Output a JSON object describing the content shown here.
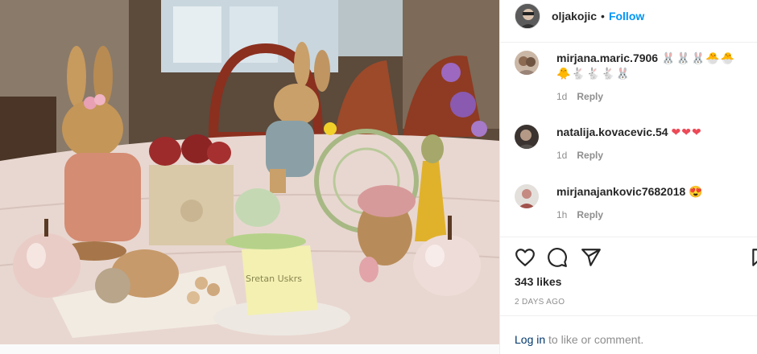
{
  "post": {
    "username": "oljakojic",
    "dot": "•",
    "follow_label": "Follow"
  },
  "photo": {
    "note_text": "Sretan Uskrs"
  },
  "comments": [
    {
      "username": "mirjana.maric.7906",
      "text": "🐰🐰🐰🐣🐣🐥🐇🐇🐇🐰",
      "age": "1d",
      "reply": "Reply"
    },
    {
      "username": "natalija.kovacevic.54",
      "text": "❤❤❤",
      "age": "1d",
      "reply": "Reply"
    },
    {
      "username": "mirjanajankovic7682018",
      "text": "😍",
      "age": "1h",
      "reply": "Reply"
    }
  ],
  "icons": [
    "heart-icon",
    "comment-icon",
    "share-icon",
    "bookmark-icon"
  ],
  "likes_label": "343 likes",
  "date_label": "2 DAYS AGO",
  "login": {
    "link": "Log in",
    "rest": " to like or comment."
  },
  "colors": {
    "follow": "#0095f6",
    "link": "#00376b",
    "muted": "#8e8e8e",
    "heart": "#ed4956"
  }
}
